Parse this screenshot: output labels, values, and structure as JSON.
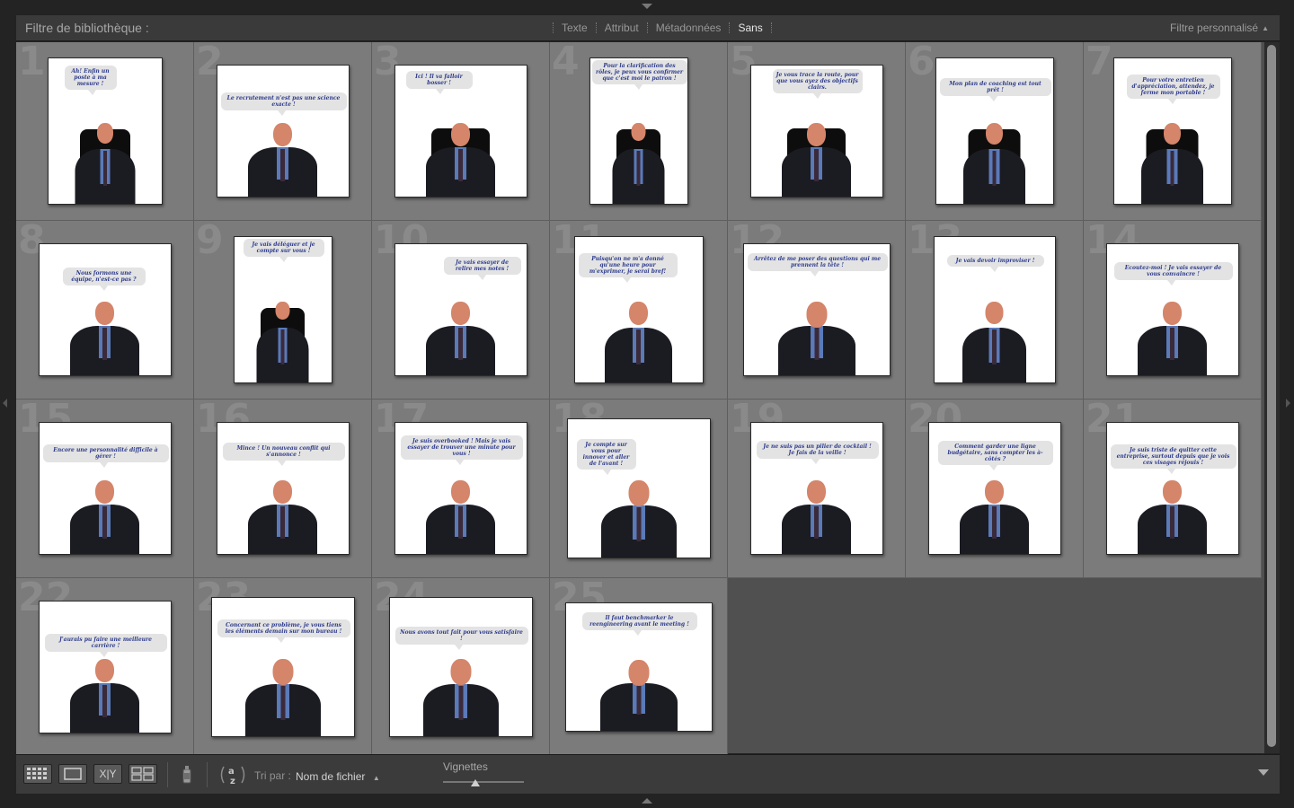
{
  "filter_bar": {
    "title": "Filtre de bibliothèque :",
    "tabs": [
      {
        "label": "Texte",
        "active": false
      },
      {
        "label": "Attribut",
        "active": false
      },
      {
        "label": "Métadonnées",
        "active": false
      },
      {
        "label": "Sans",
        "active": true
      }
    ],
    "custom_filter": "Filtre personnalisé"
  },
  "photos": [
    {
      "index": "1",
      "caption": "Ah! Enfin un poste à ma mesure !"
    },
    {
      "index": "2",
      "caption": "Le recrutement n'est pas une science exacte !"
    },
    {
      "index": "3",
      "caption": "Ici ! Il va falloir bosser !"
    },
    {
      "index": "4",
      "caption": "Pour la clarification des rôles, je peux vous confirmer que c'est moi le patron !"
    },
    {
      "index": "5",
      "caption": "Je vous trace la route, pour que vous ayez des objectifs clairs."
    },
    {
      "index": "6",
      "caption": "Mon plan de coaching est tout prêt !"
    },
    {
      "index": "7",
      "caption": "Pour votre entretien d'appréciation, attendez, je ferme mon portable !"
    },
    {
      "index": "8",
      "caption": "Nous formons une équipe, n'est-ce pas ?"
    },
    {
      "index": "9",
      "caption": "Je vais déléguer et je compte sur vous !"
    },
    {
      "index": "10",
      "caption": "Je vais essayer de relire mes notes !"
    },
    {
      "index": "11",
      "caption": "Puisqu'on ne m'a donné qu'une heure pour m'exprimer, je serai bref!"
    },
    {
      "index": "12",
      "caption": "Arrêtez de me poser des questions qui me prennent la tête !"
    },
    {
      "index": "13",
      "caption": "Je vais devoir improviser !"
    },
    {
      "index": "14",
      "caption": "Ecoutez-moi ! Je vais essayer de vous convaincre !"
    },
    {
      "index": "15",
      "caption": "Encore une personnalité difficile à gérer !"
    },
    {
      "index": "16",
      "caption": "Mince ! Un nouveau conflit qui s'annonce !"
    },
    {
      "index": "17",
      "caption": "Je suis overbooked ! Mais je vais essayer de trouver une minute pour vous !"
    },
    {
      "index": "18",
      "caption": "Je compte sur vous pour innover et aller de l'avant !"
    },
    {
      "index": "19",
      "caption": "Je ne suis pas un pilier de cocktail ! Je fais de la veille !"
    },
    {
      "index": "20",
      "caption": "Comment garder une ligne budgétaire, sans compter les à-côtés ?"
    },
    {
      "index": "21",
      "caption": "Je suis triste de quitter cette entreprise, surtout depuis que je vois ces visages réjouis !"
    },
    {
      "index": "22",
      "caption": "J'aurais pu faire une meilleure carrière !"
    },
    {
      "index": "23",
      "caption": "Concernant ce problème, je vous tiens les éléments demain sur mon bureau !"
    },
    {
      "index": "24",
      "caption": "Nous avons tout fait pour vous satisfaire !"
    },
    {
      "index": "25",
      "caption": "Il faut benchmarker le reengineering avant le meeting !"
    }
  ],
  "toolbar": {
    "sort_label": "Tri par :",
    "sort_value": "Nom de fichier",
    "thumbnails_label": "Vignettes",
    "thumbnail_size": 0.4,
    "xy_label": "X|Y"
  }
}
